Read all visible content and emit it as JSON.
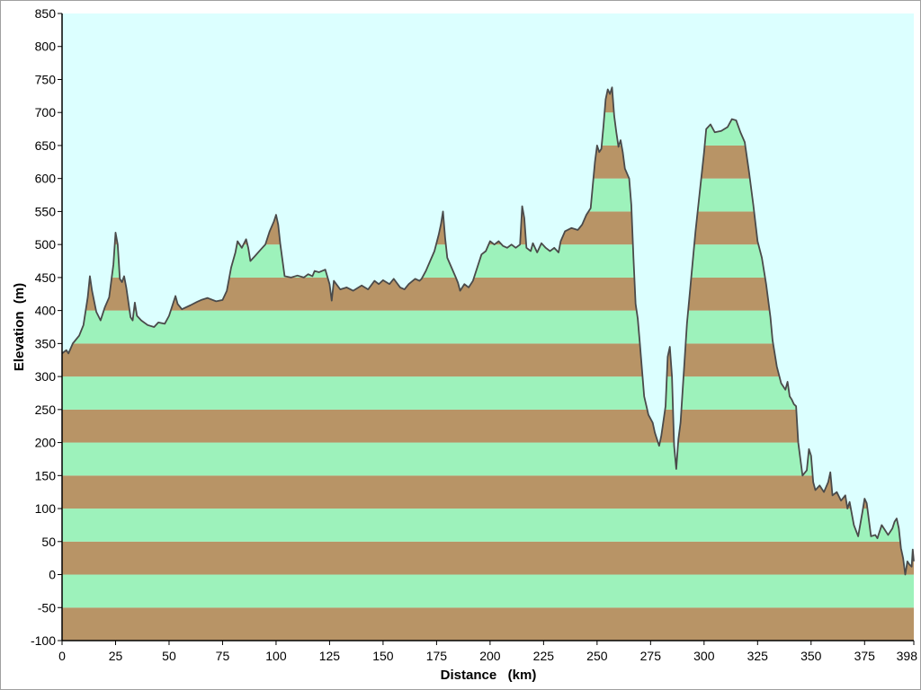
{
  "chart_data": {
    "type": "area",
    "xlabel": "Distance   (km)",
    "ylabel": "Elevation  (m)",
    "xlim": [
      0,
      398
    ],
    "ylim": [
      -100,
      850
    ],
    "x_ticks": [
      0,
      25,
      50,
      75,
      100,
      125,
      150,
      175,
      200,
      225,
      250,
      275,
      300,
      325,
      350,
      375,
      398
    ],
    "y_ticks": [
      -100,
      -50,
      0,
      50,
      100,
      150,
      200,
      250,
      300,
      350,
      400,
      450,
      500,
      550,
      600,
      650,
      700,
      750,
      800,
      850
    ],
    "band_size": 50,
    "colors": {
      "sky": "#dcffff",
      "band_green": "#9df2bb",
      "band_brown": "#b89466",
      "profile_line": "#4a4a4a",
      "axis": "#000000"
    },
    "profile": [
      [
        0,
        335
      ],
      [
        2,
        340
      ],
      [
        3,
        335
      ],
      [
        5,
        350
      ],
      [
        8,
        362
      ],
      [
        10,
        378
      ],
      [
        12,
        420
      ],
      [
        13,
        452
      ],
      [
        14,
        430
      ],
      [
        16,
        398
      ],
      [
        18,
        385
      ],
      [
        20,
        405
      ],
      [
        22,
        420
      ],
      [
        24,
        470
      ],
      [
        25,
        518
      ],
      [
        26,
        500
      ],
      [
        27,
        448
      ],
      [
        28,
        443
      ],
      [
        29,
        452
      ],
      [
        30,
        435
      ],
      [
        32,
        390
      ],
      [
        33,
        385
      ],
      [
        34,
        412
      ],
      [
        35,
        392
      ],
      [
        37,
        385
      ],
      [
        40,
        378
      ],
      [
        43,
        375
      ],
      [
        45,
        382
      ],
      [
        48,
        380
      ],
      [
        50,
        392
      ],
      [
        52,
        412
      ],
      [
        53,
        422
      ],
      [
        54,
        410
      ],
      [
        56,
        402
      ],
      [
        60,
        408
      ],
      [
        63,
        413
      ],
      [
        65,
        416
      ],
      [
        68,
        419
      ],
      [
        72,
        414
      ],
      [
        75,
        416
      ],
      [
        77,
        430
      ],
      [
        79,
        465
      ],
      [
        81,
        488
      ],
      [
        82,
        505
      ],
      [
        84,
        495
      ],
      [
        86,
        508
      ],
      [
        87,
        495
      ],
      [
        88,
        475
      ],
      [
        90,
        482
      ],
      [
        93,
        493
      ],
      [
        95,
        500
      ],
      [
        97,
        520
      ],
      [
        99,
        535
      ],
      [
        100,
        545
      ],
      [
        101,
        530
      ],
      [
        102,
        500
      ],
      [
        104,
        452
      ],
      [
        107,
        450
      ],
      [
        110,
        453
      ],
      [
        113,
        450
      ],
      [
        115,
        455
      ],
      [
        117,
        452
      ],
      [
        118,
        460
      ],
      [
        120,
        458
      ],
      [
        123,
        462
      ],
      [
        125,
        440
      ],
      [
        126,
        415
      ],
      [
        127,
        445
      ],
      [
        130,
        432
      ],
      [
        133,
        435
      ],
      [
        136,
        430
      ],
      [
        140,
        438
      ],
      [
        143,
        432
      ],
      [
        146,
        445
      ],
      [
        148,
        440
      ],
      [
        150,
        446
      ],
      [
        153,
        440
      ],
      [
        155,
        448
      ],
      [
        158,
        435
      ],
      [
        160,
        432
      ],
      [
        162,
        440
      ],
      [
        165,
        448
      ],
      [
        167,
        445
      ],
      [
        168,
        448
      ],
      [
        170,
        460
      ],
      [
        172,
        475
      ],
      [
        174,
        490
      ],
      [
        176,
        515
      ],
      [
        177,
        530
      ],
      [
        178,
        550
      ],
      [
        179,
        510
      ],
      [
        180,
        480
      ],
      [
        182,
        465
      ],
      [
        184,
        450
      ],
      [
        185,
        442
      ],
      [
        186,
        430
      ],
      [
        188,
        440
      ],
      [
        190,
        435
      ],
      [
        192,
        445
      ],
      [
        194,
        465
      ],
      [
        196,
        485
      ],
      [
        198,
        490
      ],
      [
        200,
        505
      ],
      [
        202,
        500
      ],
      [
        204,
        505
      ],
      [
        206,
        498
      ],
      [
        208,
        495
      ],
      [
        210,
        500
      ],
      [
        212,
        495
      ],
      [
        214,
        500
      ],
      [
        215,
        558
      ],
      [
        216,
        540
      ],
      [
        217,
        495
      ],
      [
        219,
        490
      ],
      [
        220,
        502
      ],
      [
        222,
        488
      ],
      [
        224,
        502
      ],
      [
        226,
        495
      ],
      [
        228,
        490
      ],
      [
        230,
        495
      ],
      [
        232,
        488
      ],
      [
        233,
        505
      ],
      [
        235,
        520
      ],
      [
        238,
        525
      ],
      [
        241,
        522
      ],
      [
        243,
        530
      ],
      [
        245,
        545
      ],
      [
        247,
        555
      ],
      [
        248,
        590
      ],
      [
        249,
        625
      ],
      [
        250,
        650
      ],
      [
        251,
        640
      ],
      [
        252,
        645
      ],
      [
        253,
        680
      ],
      [
        254,
        720
      ],
      [
        255,
        735
      ],
      [
        256,
        728
      ],
      [
        257,
        738
      ],
      [
        258,
        695
      ],
      [
        259,
        670
      ],
      [
        260,
        648
      ],
      [
        261,
        658
      ],
      [
        262,
        640
      ],
      [
        263,
        615
      ],
      [
        265,
        600
      ],
      [
        266,
        560
      ],
      [
        267,
        480
      ],
      [
        268,
        410
      ],
      [
        269,
        388
      ],
      [
        270,
        350
      ],
      [
        271,
        310
      ],
      [
        272,
        270
      ],
      [
        274,
        242
      ],
      [
        276,
        230
      ],
      [
        277,
        215
      ],
      [
        279,
        195
      ],
      [
        280,
        210
      ],
      [
        282,
        255
      ],
      [
        283,
        330
      ],
      [
        284,
        345
      ],
      [
        285,
        300
      ],
      [
        286,
        195
      ],
      [
        287,
        160
      ],
      [
        288,
        205
      ],
      [
        289,
        230
      ],
      [
        290,
        280
      ],
      [
        292,
        380
      ],
      [
        294,
        450
      ],
      [
        296,
        520
      ],
      [
        298,
        580
      ],
      [
        300,
        640
      ],
      [
        301,
        675
      ],
      [
        303,
        682
      ],
      [
        305,
        670
      ],
      [
        308,
        672
      ],
      [
        311,
        678
      ],
      [
        313,
        690
      ],
      [
        315,
        688
      ],
      [
        317,
        670
      ],
      [
        319,
        655
      ],
      [
        321,
        610
      ],
      [
        323,
        560
      ],
      [
        325,
        505
      ],
      [
        327,
        480
      ],
      [
        329,
        440
      ],
      [
        331,
        390
      ],
      [
        332,
        355
      ],
      [
        334,
        315
      ],
      [
        336,
        290
      ],
      [
        338,
        280
      ],
      [
        339,
        292
      ],
      [
        340,
        270
      ],
      [
        341,
        265
      ],
      [
        342,
        258
      ],
      [
        343,
        255
      ],
      [
        344,
        200
      ],
      [
        346,
        150
      ],
      [
        348,
        158
      ],
      [
        349,
        190
      ],
      [
        350,
        180
      ],
      [
        351,
        140
      ],
      [
        352,
        128
      ],
      [
        354,
        135
      ],
      [
        356,
        125
      ],
      [
        358,
        140
      ],
      [
        359,
        155
      ],
      [
        360,
        120
      ],
      [
        362,
        125
      ],
      [
        364,
        112
      ],
      [
        366,
        120
      ],
      [
        367,
        100
      ],
      [
        368,
        110
      ],
      [
        370,
        75
      ],
      [
        372,
        58
      ],
      [
        374,
        95
      ],
      [
        375,
        115
      ],
      [
        376,
        108
      ],
      [
        378,
        58
      ],
      [
        380,
        60
      ],
      [
        381,
        55
      ],
      [
        383,
        75
      ],
      [
        385,
        65
      ],
      [
        386,
        60
      ],
      [
        388,
        70
      ],
      [
        389,
        80
      ],
      [
        390,
        85
      ],
      [
        391,
        70
      ],
      [
        392,
        40
      ],
      [
        393,
        25
      ],
      [
        394,
        0
      ],
      [
        395,
        20
      ],
      [
        396,
        15
      ],
      [
        397,
        12
      ],
      [
        397.5,
        38
      ],
      [
        398,
        20
      ]
    ]
  }
}
